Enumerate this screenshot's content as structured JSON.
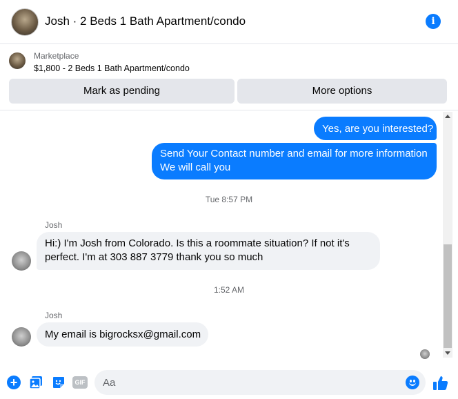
{
  "header": {
    "title": "Josh · 2 Beds 1 Bath Apartment/condo",
    "avatar_icon": "house-photo",
    "info_icon": "info-icon",
    "info_glyph": "i",
    "accent_color": "#0a7cff"
  },
  "marketplace": {
    "label": "Marketplace",
    "item": "$1,800 - 2 Beds 1 Bath Apartment/condo",
    "mark_pending_label": "Mark as pending",
    "more_options_label": "More options"
  },
  "conversation": {
    "outgoing": [
      {
        "lines": [
          "Yes, are you interested?"
        ]
      },
      {
        "lines": [
          "Send Your Contact number and email for more information",
          "We will call you"
        ]
      }
    ],
    "timestamps": [
      "Tue 8:57 PM",
      "1:52 AM"
    ],
    "incoming": [
      {
        "sender": "Josh",
        "lines": [
          "Hi:) I'm Josh from Colorado. Is this a roommate situation? If not it's",
          "perfect. I'm at 303 887 3779 thank you so much"
        ]
      },
      {
        "sender": "Josh",
        "lines": [
          "My email is bigrocksx@gmail.com"
        ]
      }
    ]
  },
  "composer": {
    "placeholder": "Aa",
    "icons": [
      "plus-icon",
      "photo-icon",
      "sticker-icon",
      "gif-icon",
      "emoji-icon",
      "like-icon"
    ],
    "plus_glyph": "+",
    "gif_label": "GIF"
  }
}
